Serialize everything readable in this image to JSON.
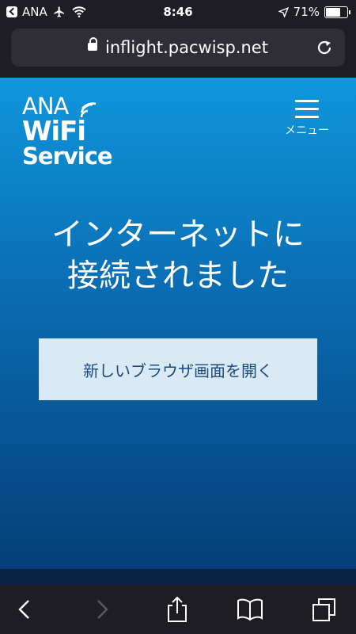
{
  "status_bar": {
    "back_app": "ANA",
    "time": "8:46",
    "battery_percent": "71%",
    "battery_level": 0.71,
    "icons": [
      "back-to-app-icon",
      "airplane-icon",
      "wifi-icon",
      "location-arrow-icon",
      "battery-icon"
    ]
  },
  "address_bar": {
    "url": "inflight.pacwisp.net",
    "icons": [
      "lock-icon",
      "reload-icon"
    ]
  },
  "header": {
    "logo_line1": "ANA",
    "logo_line2": "WiFi",
    "logo_line3": "Service",
    "menu_label": "メニュー",
    "icons": [
      "menu-icon",
      "wifi-signal-icon"
    ]
  },
  "main": {
    "headline_line1": "インターネットに",
    "headline_line2": "接続されました",
    "open_browser_button": "新しいブラウザ画面を開く"
  },
  "toolbar": {
    "icons": [
      "back-icon",
      "forward-icon",
      "share-icon",
      "bookmarks-icon",
      "tabs-icon"
    ]
  },
  "colors": {
    "page_top": "#0f96dd",
    "page_bottom": "#053e79",
    "button_bg": "#daeaf4",
    "button_text": "#1a4a80",
    "chrome_bg": "#1e1d24"
  }
}
